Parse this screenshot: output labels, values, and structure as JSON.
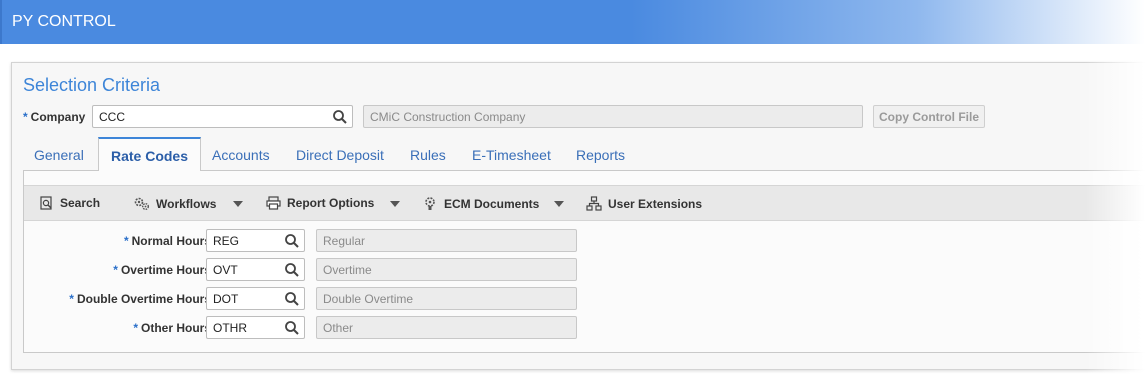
{
  "app": {
    "title": "PY CONTROL"
  },
  "selection": {
    "title": "Selection Criteria",
    "company_label": "Company",
    "company_value": "CCC",
    "company_desc": "CMiC Construction Company",
    "copy_button": "Copy Control File"
  },
  "tabs": [
    {
      "label": "General"
    },
    {
      "label": "Rate Codes",
      "active": true
    },
    {
      "label": "Accounts"
    },
    {
      "label": "Direct Deposit"
    },
    {
      "label": "Rules"
    },
    {
      "label": "E-Timesheet"
    },
    {
      "label": "Reports"
    }
  ],
  "toolbar": {
    "search": "Search",
    "workflows": "Workflows",
    "report_options": "Report Options",
    "ecm_documents": "ECM Documents",
    "user_extensions": "User Extensions"
  },
  "rows": [
    {
      "label": "Normal Hours",
      "code": "REG",
      "desc": "Regular"
    },
    {
      "label": "Overtime Hours",
      "code": "OVT",
      "desc": "Overtime"
    },
    {
      "label": "Double Overtime Hours",
      "code": "DOT",
      "desc": "Double Overtime"
    },
    {
      "label": "Other Hours",
      "code": "OTHR",
      "desc": "Other"
    }
  ],
  "required_marker": "*",
  "colors": {
    "title_bar": "#4a8ae0",
    "accent": "#3d85d8"
  }
}
